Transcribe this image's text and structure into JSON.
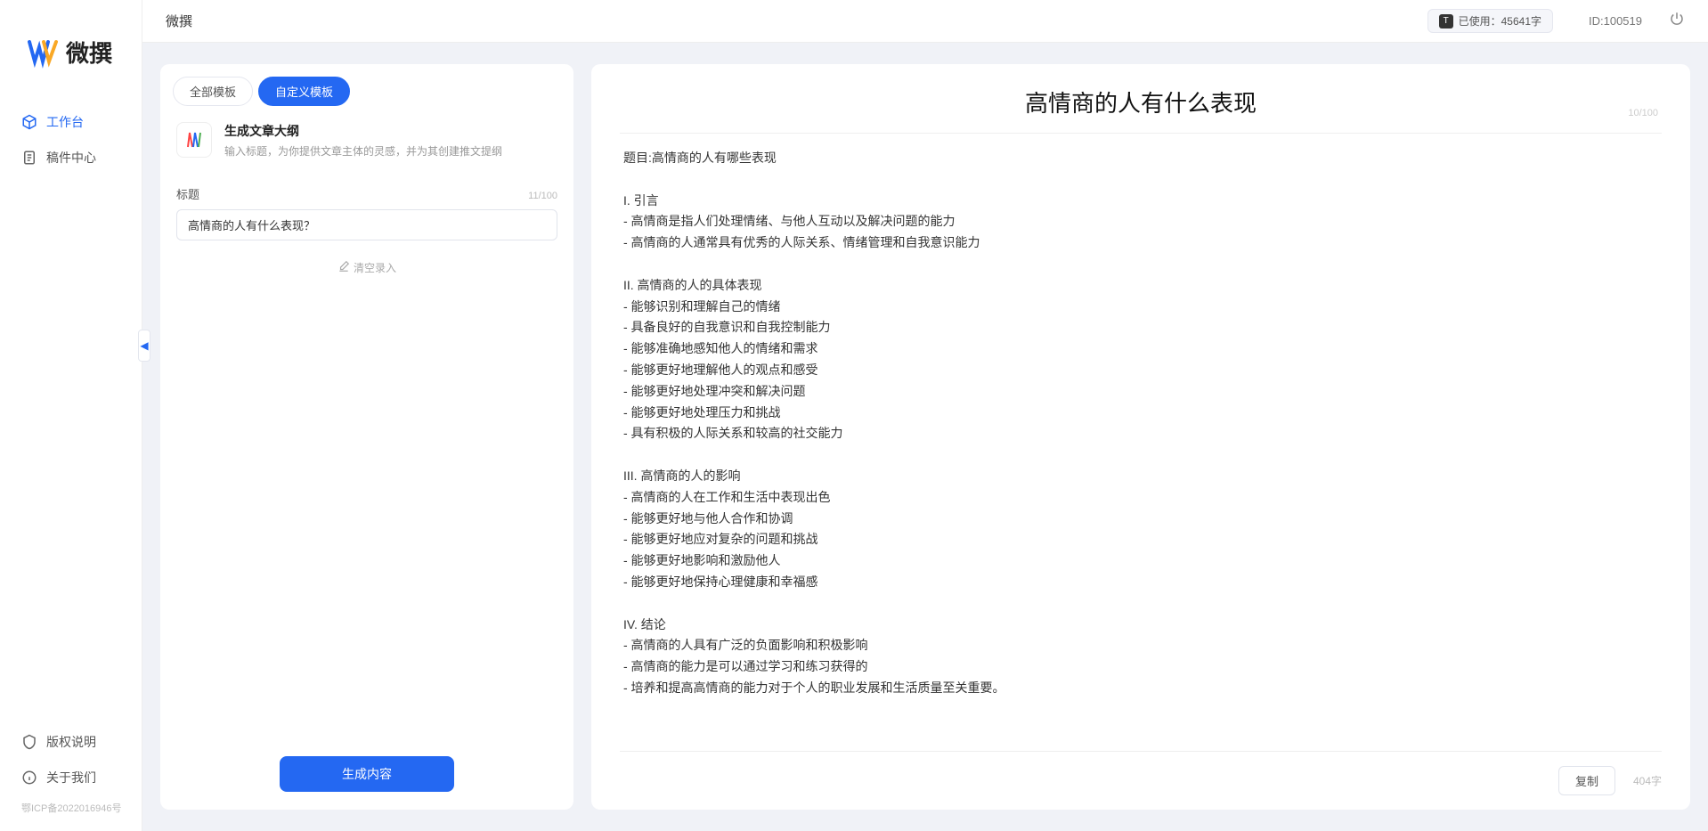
{
  "app": {
    "brand": "微撰",
    "pageTitle": "微撰"
  },
  "topbar": {
    "usageBadge": "T",
    "usageLabel": "已使用：45641字",
    "idLabel": "ID:100519"
  },
  "sidebar": {
    "items": [
      {
        "label": "工作台",
        "icon": "cube",
        "active": true
      },
      {
        "label": "稿件中心",
        "icon": "doc",
        "active": false
      }
    ],
    "footerItems": [
      {
        "label": "版权说明",
        "icon": "shield"
      },
      {
        "label": "关于我们",
        "icon": "info"
      }
    ],
    "icp": "鄂ICP备2022016946号"
  },
  "left": {
    "tabs": [
      {
        "label": "全部模板",
        "active": false
      },
      {
        "label": "自定义模板",
        "active": true
      }
    ],
    "template": {
      "title": "生成文章大纲",
      "desc": "输入标题，为你提供文章主体的灵感，并为其创建推文提纲"
    },
    "form": {
      "titleLabel": "标题",
      "titleCount": "11/100",
      "titleValue": "高情商的人有什么表现？",
      "clearLabel": "清空录入"
    },
    "generateLabel": "生成内容"
  },
  "right": {
    "title": "高情商的人有什么表现",
    "titleCount": "10/100",
    "content": "题目:高情商的人有哪些表现\n\nI. 引言\n- 高情商是指人们处理情绪、与他人互动以及解决问题的能力\n- 高情商的人通常具有优秀的人际关系、情绪管理和自我意识能力\n\nII. 高情商的人的具体表现\n- 能够识别和理解自己的情绪\n- 具备良好的自我意识和自我控制能力\n- 能够准确地感知他人的情绪和需求\n- 能够更好地理解他人的观点和感受\n- 能够更好地处理冲突和解决问题\n- 能够更好地处理压力和挑战\n- 具有积极的人际关系和较高的社交能力\n\nIII. 高情商的人的影响\n- 高情商的人在工作和生活中表现出色\n- 能够更好地与他人合作和协调\n- 能够更好地应对复杂的问题和挑战\n- 能够更好地影响和激励他人\n- 能够更好地保持心理健康和幸福感\n\nIV. 结论\n- 高情商的人具有广泛的负面影响和积极影响\n- 高情商的能力是可以通过学习和练习获得的\n- 培养和提高高情商的能力对于个人的职业发展和生活质量至关重要。",
    "copyLabel": "复制",
    "wordCountLabel": "404字"
  }
}
